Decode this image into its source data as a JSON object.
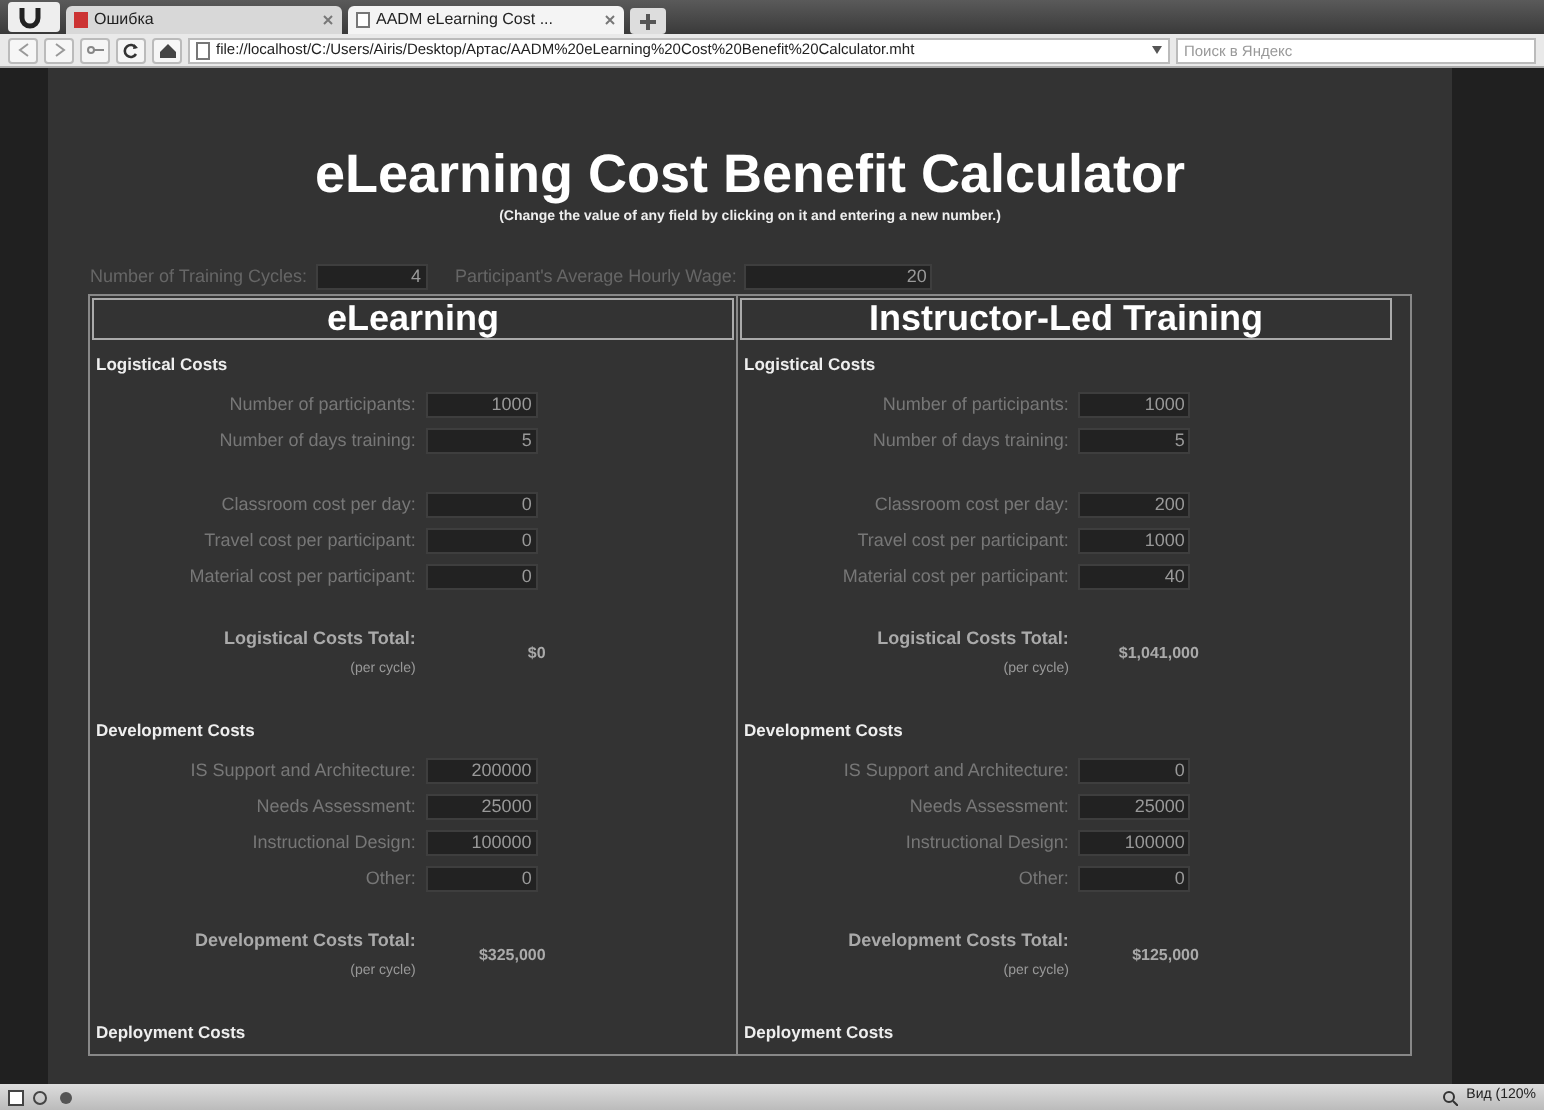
{
  "browser": {
    "tabs": [
      {
        "label": "Ошибка",
        "selected": false
      },
      {
        "label": "AADM eLearning Cost ...",
        "selected": true
      }
    ],
    "address": "file://localhost/C:/Users/Airis/Desktop/Артас/AADM%20eLearning%20Cost%20Benefit%20Calculator.mht",
    "search": {
      "placeholder": "Поиск в Яндекс"
    },
    "status": "Вид (120%"
  },
  "page": {
    "title": "eLearning Cost Benefit Calculator",
    "subtitle": "(Change the value of any field by clicking on it and entering a new number.)",
    "globals": [
      {
        "label": "Number of Training Cycles:",
        "value": "4"
      },
      {
        "label": "Participant's Average Hourly Wage:",
        "value": "20"
      }
    ],
    "columns": [
      {
        "heading": "eLearning",
        "sections": [
          {
            "title": "Logistical Costs",
            "groups": [
              [
                {
                  "label": "Number of participants:",
                  "value": "1000"
                },
                {
                  "label": "Number of days training:",
                  "value": "5"
                }
              ],
              [
                {
                  "label": "Classroom cost per day:",
                  "value": "0"
                },
                {
                  "label": "Travel cost per participant:",
                  "value": "0"
                },
                {
                  "label": "Material cost per participant:",
                  "value": "0"
                }
              ]
            ],
            "total": {
              "label": "Logistical Costs Total:",
              "note": "(per cycle)",
              "value": "$0"
            }
          },
          {
            "title": "Development Costs",
            "groups": [
              [
                {
                  "label": "IS Support and Architecture:",
                  "value": "200000"
                },
                {
                  "label": "Needs Assessment:",
                  "value": "25000"
                },
                {
                  "label": "Instructional Design:",
                  "value": "100000"
                },
                {
                  "label": "Other:",
                  "value": "0"
                }
              ]
            ],
            "total": {
              "label": "Development Costs Total:",
              "note": "(per cycle)",
              "value": "$325,000"
            }
          },
          {
            "title": "Deployment Costs"
          }
        ]
      },
      {
        "heading": "Instructor-Led Training",
        "sections": [
          {
            "title": "Logistical Costs",
            "groups": [
              [
                {
                  "label": "Number of participants:",
                  "value": "1000"
                },
                {
                  "label": "Number of days training:",
                  "value": "5"
                }
              ],
              [
                {
                  "label": "Classroom cost per day:",
                  "value": "200"
                },
                {
                  "label": "Travel cost per participant:",
                  "value": "1000"
                },
                {
                  "label": "Material cost per participant:",
                  "value": "40"
                }
              ]
            ],
            "total": {
              "label": "Logistical Costs Total:",
              "note": "(per cycle)",
              "value": "$1,041,000"
            }
          },
          {
            "title": "Development Costs",
            "groups": [
              [
                {
                  "label": "IS Support and Architecture:",
                  "value": "0"
                },
                {
                  "label": "Needs Assessment:",
                  "value": "25000"
                },
                {
                  "label": "Instructional Design:",
                  "value": "100000"
                },
                {
                  "label": "Other:",
                  "value": "0"
                }
              ]
            ],
            "total": {
              "label": "Development Costs Total:",
              "note": "(per cycle)",
              "value": "$125,000"
            }
          },
          {
            "title": "Deployment Costs"
          }
        ]
      }
    ]
  }
}
